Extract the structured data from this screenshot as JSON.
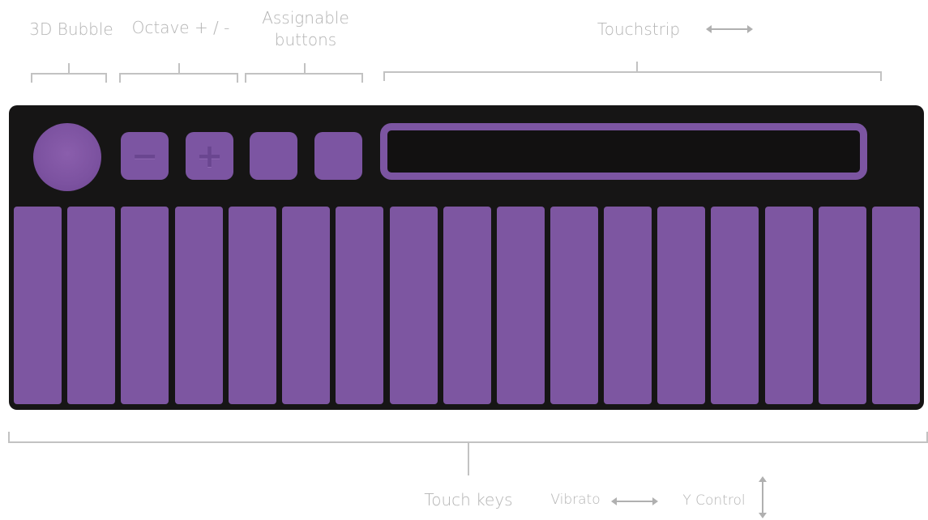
{
  "labels": {
    "bubble": "3D Bubble",
    "octave": "Octave + / -",
    "assignable_line1": "Assignable",
    "assignable_line2": "buttons",
    "touchstrip": "Touchstrip",
    "touch_keys": "Touch keys",
    "vibrato": "Vibrato",
    "y_control": "Y Control"
  },
  "buttons": {
    "minus_symbol": "−",
    "plus_symbol": "+"
  },
  "colors": {
    "device_body": "#161515",
    "accent_purple": "#7d56a1",
    "label_gray": "#b3b3b3"
  },
  "keys_count": 17
}
